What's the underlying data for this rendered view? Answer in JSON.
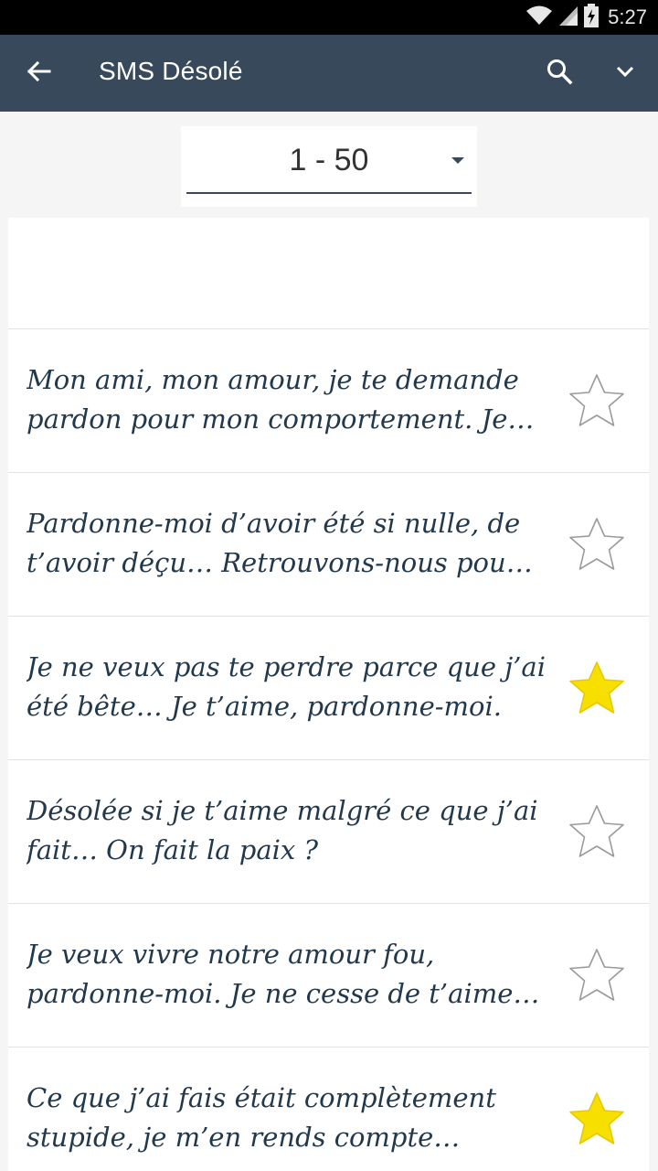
{
  "status_bar": {
    "time": "5:27",
    "icons": [
      "wifi-icon",
      "cell-signal-icon",
      "battery-charging-icon"
    ]
  },
  "app_bar": {
    "title": "SMS Désolé",
    "icons": [
      "arrow-back-icon",
      "search-icon",
      "chevron-down-icon"
    ]
  },
  "range_select": {
    "value": "1 - 50"
  },
  "messages": [
    {
      "text": "Mon ami, mon amour, je te demande pardon pour mon comportement. Je…",
      "favorite": false
    },
    {
      "text": "Pardonne-moi d’avoir été si nulle, de t’avoir déçu… Retrouvons-nous pou…",
      "favorite": false
    },
    {
      "text": "Je ne veux pas te perdre parce que j’ai été bête… Je t’aime, pardonne-moi.",
      "favorite": true
    },
    {
      "text": "Désolée si je t’aime malgré ce que j’ai fait… On fait la paix ?",
      "favorite": false
    },
    {
      "text": "Je veux vivre notre amour fou, pardonne-moi. Je ne cesse de t’aime…",
      "favorite": false
    },
    {
      "text": "Ce que j’ai fais était complètement stupide, je m’en rends compte…",
      "favorite": true
    }
  ],
  "colors": {
    "app_bar": "#37495b",
    "message_text": "#22384c",
    "star_filled": "#f7df00",
    "star_outline": "#9a9a9a"
  }
}
